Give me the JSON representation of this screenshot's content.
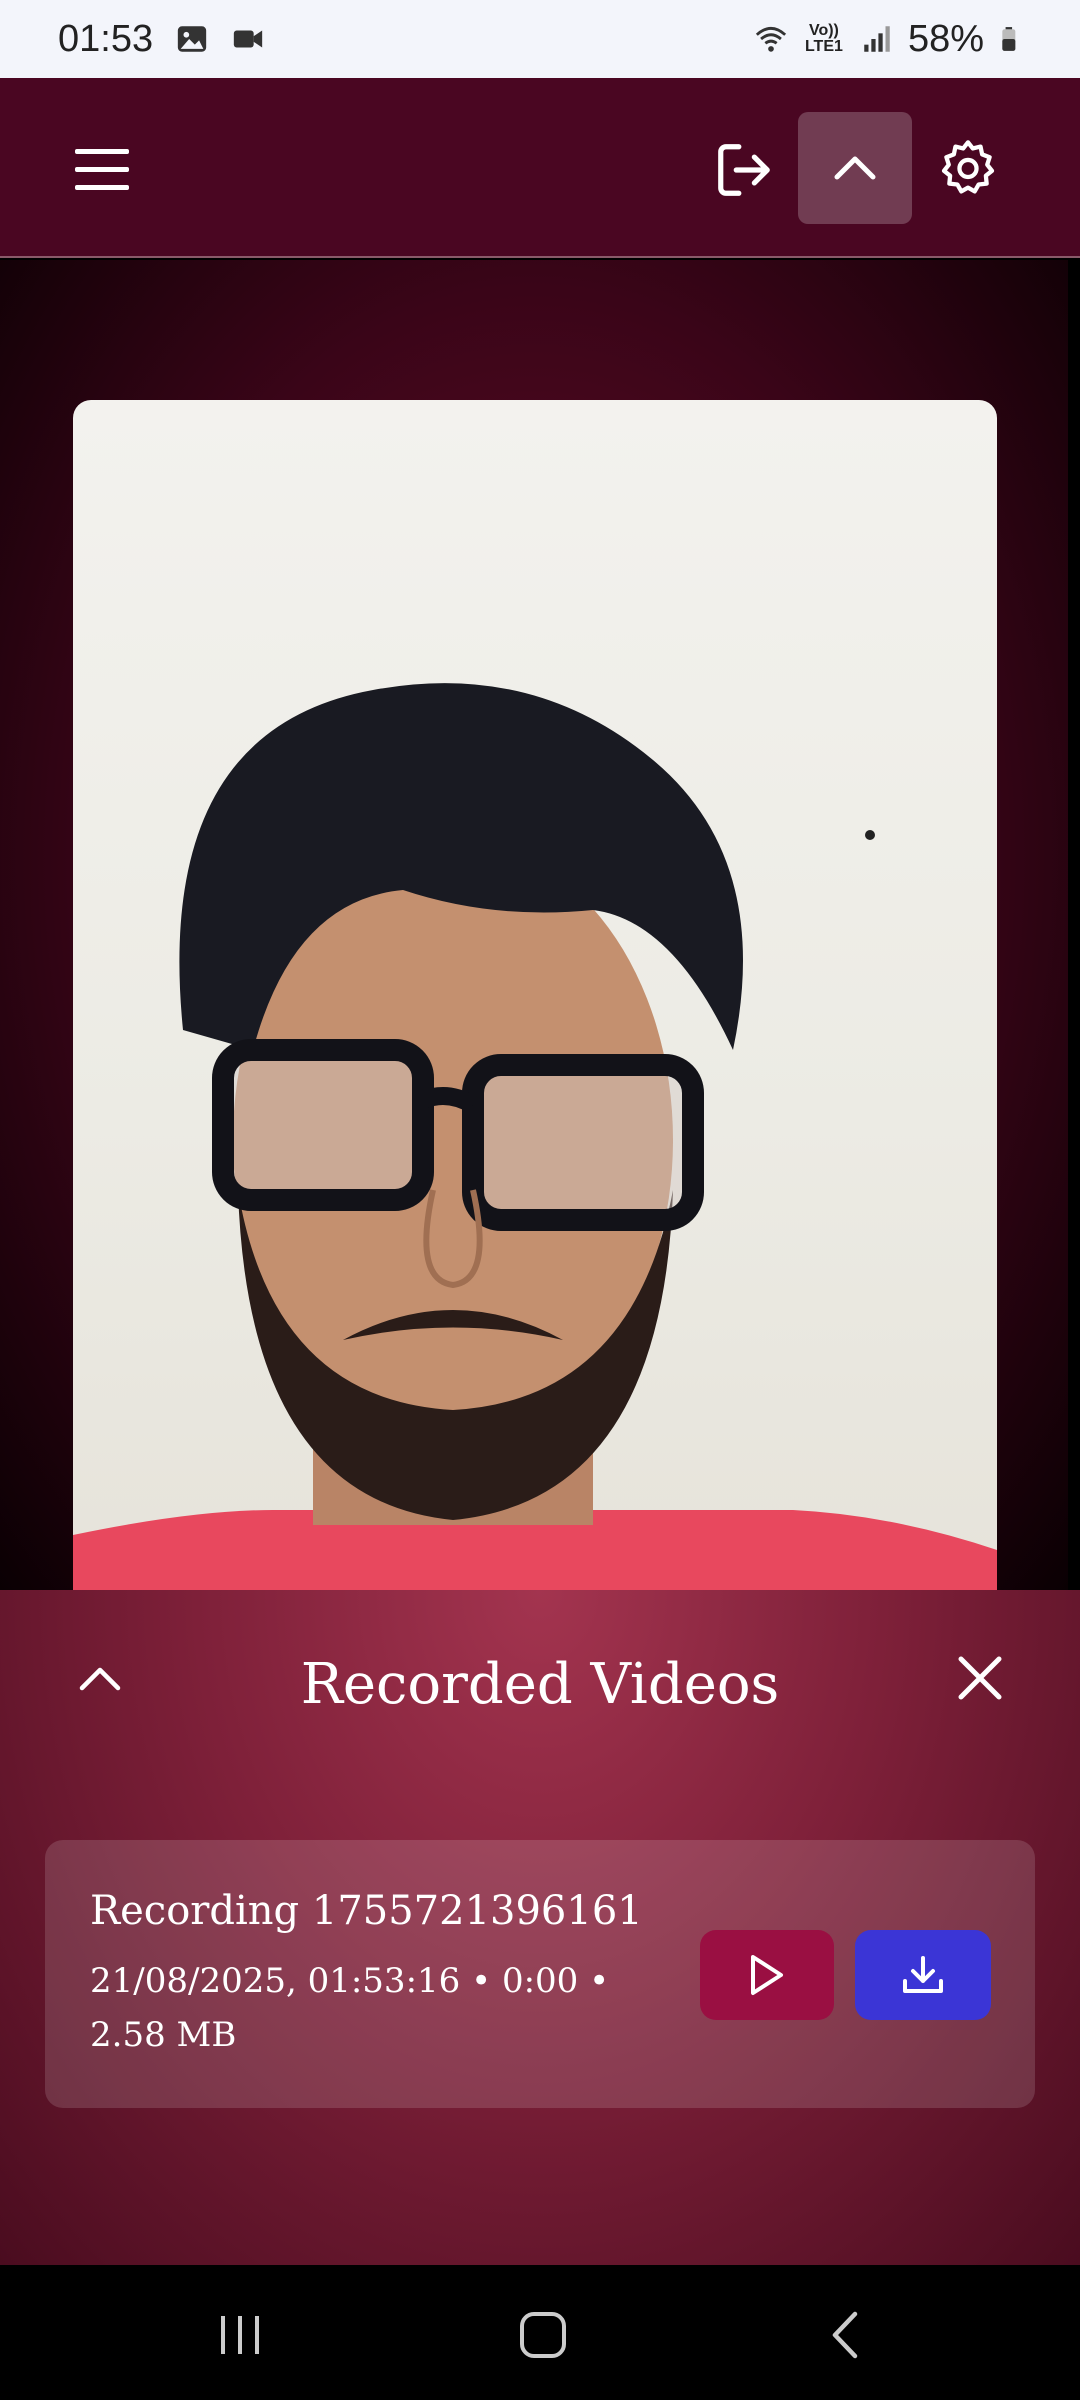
{
  "status_bar": {
    "time": "01:53",
    "battery": "58%",
    "network": "Vo)) LTE1",
    "icons": [
      "gallery-icon",
      "video-icon",
      "wifi-icon",
      "signal-icon",
      "battery-icon"
    ]
  },
  "app_bar": {
    "icons": [
      "menu-icon",
      "logout-icon",
      "chevron-up-icon",
      "settings-icon"
    ],
    "colors": {
      "background": "#4a0622"
    }
  },
  "sheet": {
    "title": "Recorded Videos",
    "recordings": [
      {
        "title": "Recording 1755721396161",
        "meta": "21/08/2025, 01:53:16 • 0:00 • 2.58 MB"
      }
    ],
    "colors": {
      "play": "#9a0f42",
      "download": "#3b35d6"
    }
  },
  "nav_bar": {
    "icons": [
      "recents-icon",
      "home-icon",
      "back-icon"
    ]
  }
}
